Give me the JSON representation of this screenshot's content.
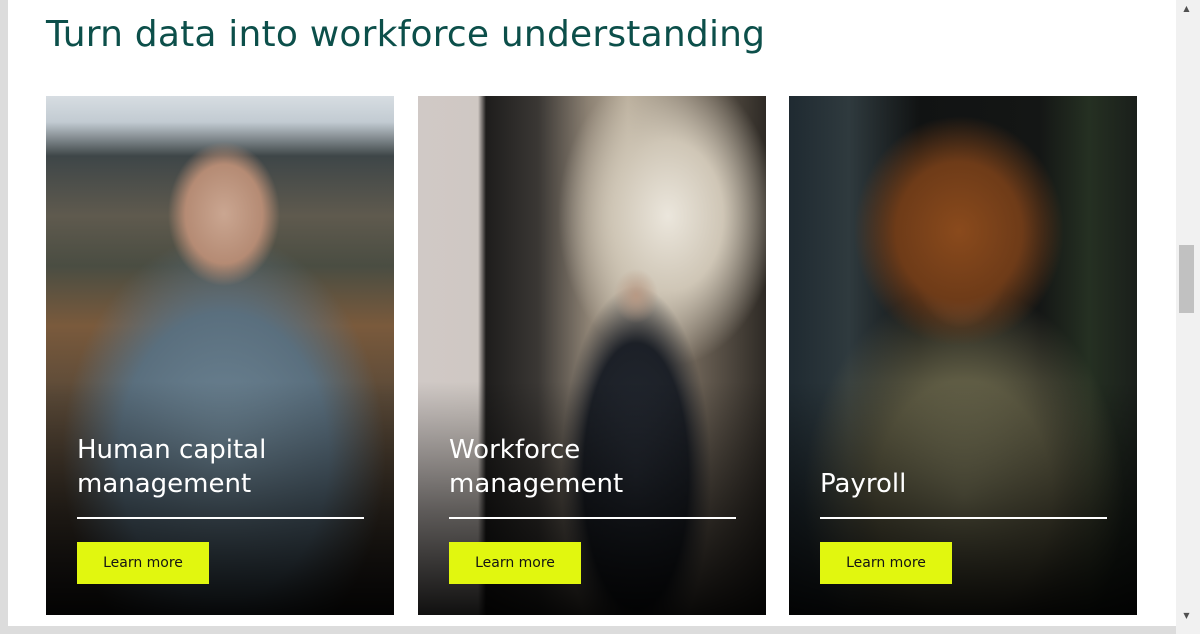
{
  "section": {
    "heading": "Turn data into workforce understanding"
  },
  "cards": [
    {
      "title": "Human capital\nmanagement",
      "button_label": "Learn more",
      "image": "man-with-glasses-in-office-photo"
    },
    {
      "title": "Workforce\nmanagement",
      "button_label": "Learn more",
      "image": "man-in-suit-in-arcade-photo"
    },
    {
      "title": "Payroll",
      "button_label": "Learn more",
      "image": "woman-with-curly-hair-photo"
    }
  ],
  "scrollbar": {
    "up_arrow": "▲",
    "down_arrow": "▼"
  },
  "colors": {
    "heading": "#0c4f4a",
    "button_bg": "#e1f70f",
    "button_text": "#141414",
    "card_text": "#ffffff"
  }
}
